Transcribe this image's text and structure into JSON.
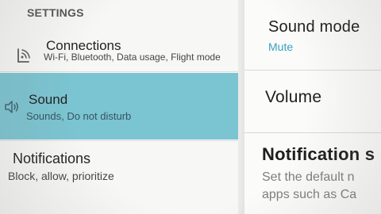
{
  "settings": {
    "section_header": "SETTINGS",
    "items": [
      {
        "id": "connections",
        "label": "Connections",
        "subtitle": "Wi-Fi, Bluetooth, Data usage, Flight mode",
        "icon": "connections-icon"
      },
      {
        "id": "sound",
        "label": "Sound",
        "subtitle": "Sounds, Do not disturb",
        "icon": "sound-icon",
        "selected": true
      },
      {
        "id": "notifications",
        "label": "Notifications",
        "subtitle": "Block, allow, prioritize"
      }
    ]
  },
  "details": {
    "sound_mode": {
      "title": "Sound mode",
      "value": "Mute"
    },
    "volume": {
      "title": "Volume"
    },
    "notification": {
      "title": "Notification s",
      "description_lines": [
        "Set the default n",
        "apps such as Ca"
      ]
    }
  },
  "colors": {
    "selected_row": "#7bc4d1",
    "accent_value": "#3aa0bd",
    "background": "#f7f7f5",
    "text_primary": "#222222",
    "text_secondary": "#444444"
  }
}
